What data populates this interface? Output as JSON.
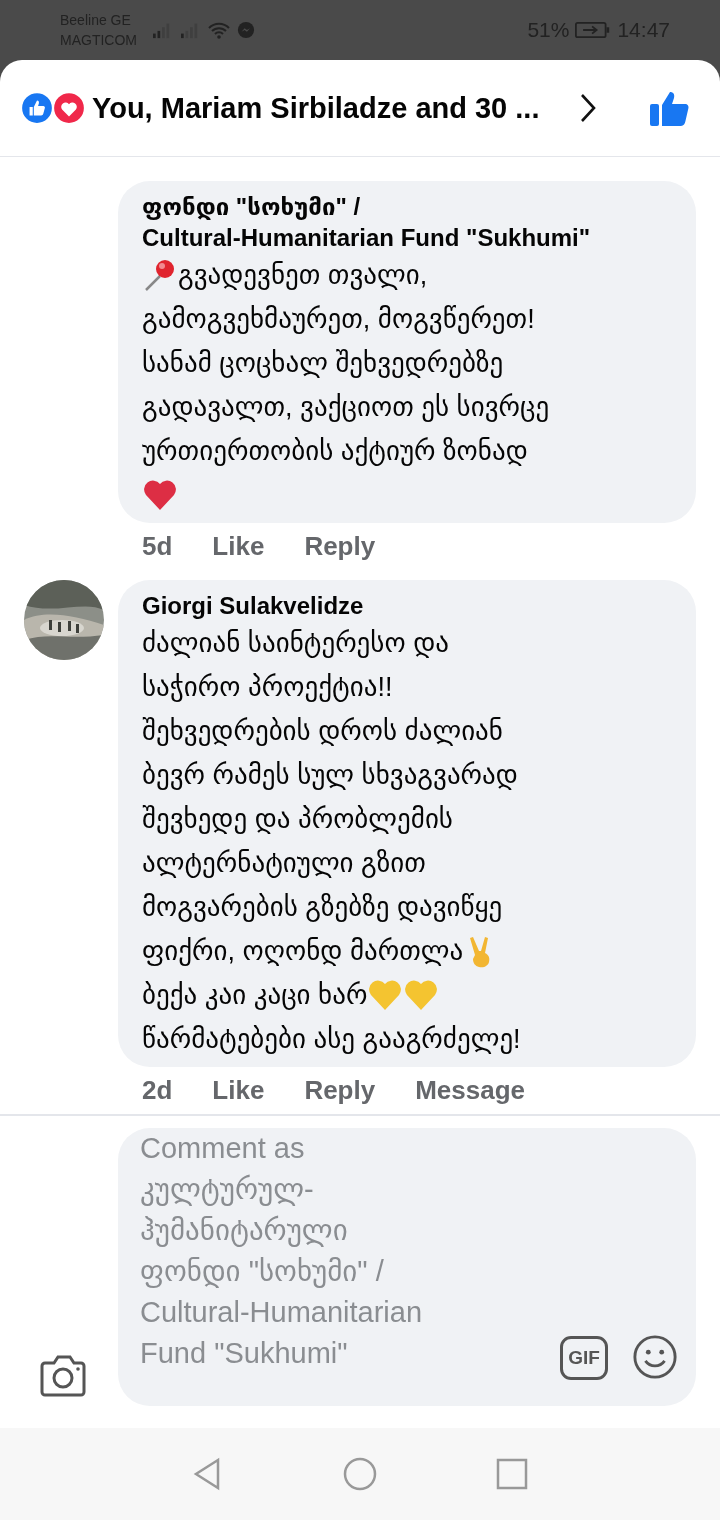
{
  "status_bar": {
    "carrier_1": "Beeline GE",
    "carrier_2": "MAGTICOM",
    "battery": "51%",
    "time": "14:47"
  },
  "header": {
    "reactions_text": "You, Mariam Sirbiladze and 30 ..."
  },
  "comments": [
    {
      "avatar": false,
      "author_lines": [
        "ფონდი \"სოხუმი\" /",
        "Cultural-Humanitarian Fund \"Sukhumi\""
      ],
      "lines": [
        [
          {
            "kind": "pin"
          },
          {
            "kind": "text",
            "text": "გვადევნეთ თვალი,"
          }
        ],
        [
          {
            "kind": "text",
            "text": "გამოგვეხმაურეთ, მოგვწერეთ!"
          }
        ],
        [
          {
            "kind": "text",
            "text": "სანამ ცოცხალ შეხვედრებზე"
          }
        ],
        [
          {
            "kind": "text",
            "text": "გადავალთ, ვაქციოთ ეს სივრცე"
          }
        ],
        [
          {
            "kind": "text",
            "text": "ურთიერთობის აქტიურ ზონად"
          }
        ],
        [
          {
            "kind": "red-heart"
          }
        ]
      ],
      "actions": [
        "5d",
        "Like",
        "Reply"
      ]
    },
    {
      "avatar": true,
      "author_lines": [
        "Giorgi Sulakvelidze"
      ],
      "lines": [
        [
          {
            "kind": "text",
            "text": "ძალიან საინტერესო და"
          }
        ],
        [
          {
            "kind": "text",
            "text": "საჭირო  პროექტია!!"
          }
        ],
        [
          {
            "kind": "text",
            "text": "შეხვედრების დროს ძალიან"
          }
        ],
        [
          {
            "kind": "text",
            "text": "ბევრ რამეს სულ სხვაგვარად"
          }
        ],
        [
          {
            "kind": "text",
            "text": "შევხედე და პრობლემის"
          }
        ],
        [
          {
            "kind": "text",
            "text": "ალტერნატიული გზით"
          }
        ],
        [
          {
            "kind": "text",
            "text": "მოგვარების გზებზე დავიწყე"
          }
        ],
        [
          {
            "kind": "text",
            "text": "ფიქრი, ოღონდ მართლა"
          },
          {
            "kind": "victory-hand"
          }
        ],
        [
          {
            "kind": "text",
            "text": "ბექა კაი კაცი ხარ"
          },
          {
            "kind": "yellow-heart"
          },
          {
            "kind": "yellow-heart"
          }
        ],
        [
          {
            "kind": "text",
            "text": "წარმატებები ასე გააგრძელე!"
          }
        ]
      ],
      "actions": [
        "2d",
        "Like",
        "Reply",
        "Message"
      ]
    }
  ],
  "composer": {
    "placeholder": "Comment as კულტურულ-ჰუმანიტარული ფონდი \"სოხუმი\" / Cultural-Humanitarian Fund \"Sukhumi\"",
    "gif_label": "GIF"
  }
}
